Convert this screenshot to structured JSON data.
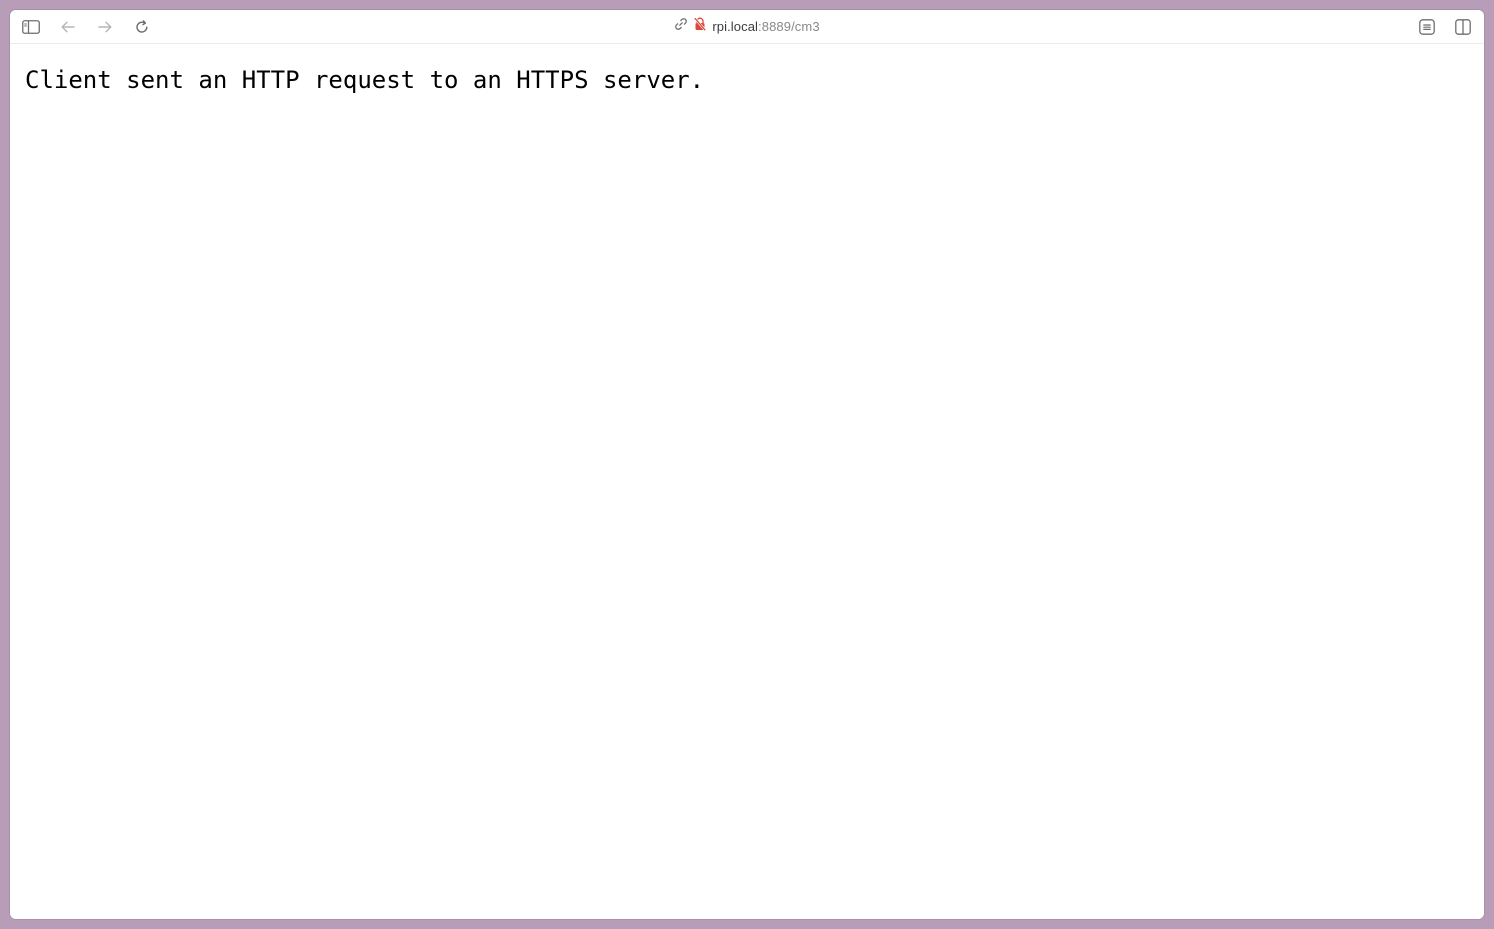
{
  "browser": {
    "address_bar": {
      "host": "rpi.local",
      "rest": ":8889/cm3"
    },
    "icons": {
      "sidebar": "sidebar-toggle-icon",
      "back": "arrow-left-icon",
      "forward": "arrow-right-icon",
      "reload": "reload-icon",
      "link": "link-icon",
      "insecure": "not-secure-lock-icon",
      "reader": "reader-icon",
      "split": "split-view-icon"
    },
    "colors": {
      "insecure_accent": "#d84b3b",
      "window_backdrop": "#b79db8"
    }
  },
  "page": {
    "message": "Client sent an HTTP request to an HTTPS server."
  }
}
